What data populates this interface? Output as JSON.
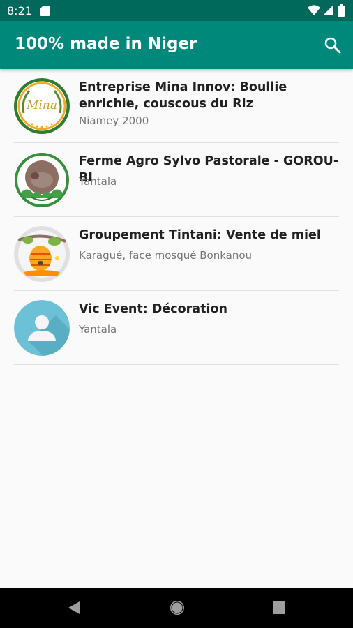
{
  "status_bar": {
    "time": "8:21",
    "icons": [
      "sd-card-icon",
      "wifi-icon",
      "signal-icon",
      "battery-icon"
    ]
  },
  "app_bar": {
    "title": "100% made in Niger",
    "search_icon": "search-icon"
  },
  "colors": {
    "status_bar": "#00695c",
    "app_bar": "#00897b",
    "title_text": "#212121",
    "subtitle_text": "#757575"
  },
  "listings": [
    {
      "title": "Entreprise Mina Innov: Boullie enrichie, couscous du Riz",
      "location": "Niamey 2000",
      "logo": "mina-innov-logo",
      "logo_text": "Mina"
    },
    {
      "title": "Ferme Agro Sylvo Pastorale - GOROU-BI",
      "location": "Yantala",
      "logo": "ferme-agro-logo"
    },
    {
      "title": "Groupement Tintani: Vente de miel",
      "location": "Karagué, face mosqué Bonkanou",
      "logo": "beehive-logo"
    },
    {
      "title": "Vic Event: Décoration",
      "location": "Yantala",
      "logo": "default-person-avatar"
    }
  ],
  "nav_bar": {
    "buttons": [
      "back-icon",
      "home-icon",
      "recents-icon"
    ]
  }
}
